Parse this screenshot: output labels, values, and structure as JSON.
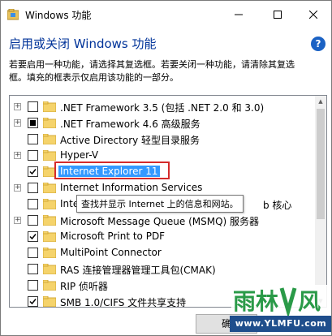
{
  "window": {
    "title": "Windows 功能",
    "heading": "启用或关闭 Windows 功能",
    "description_line1": "若要启用一种功能，请选择其复选框。若要关闭一种功能，请清除其复选",
    "description_line2": "框。填充的框表示仅启用该功能的一部分。"
  },
  "features": {
    "items": [
      {
        "label": ".NET Framework 3.5 (包括 .NET 2.0 和 3.0)",
        "state": "unchecked",
        "expandable": true
      },
      {
        "label": ".NET Framework 4.6 高级服务",
        "state": "partial",
        "expandable": true
      },
      {
        "label": "Active Directory 轻型目录服务",
        "state": "unchecked",
        "expandable": false
      },
      {
        "label": "Hyper-V",
        "state": "unchecked",
        "expandable": true
      },
      {
        "label": "Internet Explorer 11",
        "state": "checked",
        "expandable": false,
        "selected": true
      },
      {
        "label": "Internet Information Services",
        "state": "unchecked",
        "expandable": true
      },
      {
        "label": "Inte",
        "label_tail": "b 核心",
        "state": "unchecked",
        "expandable": false
      },
      {
        "label": "Microsoft Message Queue (MSMQ) 服务器",
        "state": "unchecked",
        "expandable": true
      },
      {
        "label": "Microsoft Print to PDF",
        "state": "checked",
        "expandable": false
      },
      {
        "label": "MultiPoint Connector",
        "state": "unchecked",
        "expandable": false
      },
      {
        "label": "RAS 连接管理器管理工具包(CMAK)",
        "state": "unchecked",
        "expandable": false
      },
      {
        "label": "RIP 侦听器",
        "state": "unchecked",
        "expandable": false
      },
      {
        "label": "SMB 1.0/CIFS 文件共享支持",
        "state": "checked",
        "expandable": false
      }
    ]
  },
  "tooltip": {
    "text": "查找并显示 Internet 上的信息和网站。"
  },
  "footer": {
    "ok_label": "确"
  },
  "watermark": {
    "text": "www.YLMFU.com",
    "logo_text": "雨林木风"
  },
  "colors": {
    "heading": "#003399",
    "selection": "#3399ff",
    "highlight_box": "#d42b2b",
    "help_icon": "#1b62c4",
    "folder": "#f5d36b",
    "watermark_bg": "#1f4e8c"
  }
}
